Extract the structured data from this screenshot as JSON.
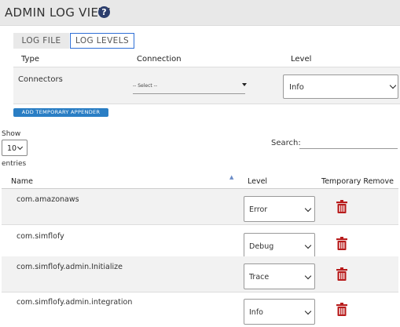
{
  "header": {
    "title": "ADMIN LOG VIEW",
    "help_icon": "help-icon"
  },
  "tabs": [
    {
      "label": "LOG FILE",
      "active": false
    },
    {
      "label": "LOG LEVELS",
      "active": true
    }
  ],
  "connectors": {
    "headers": {
      "type": "Type",
      "connection": "Connection",
      "level": "Level"
    },
    "row": {
      "type": "Connectors",
      "connection": "-- Select --",
      "level": "Info"
    }
  },
  "add_appender_label": "ADD TEMPORARY APPENDER",
  "table_controls": {
    "show_label": "Show",
    "page_length": "10",
    "entries_label": "entries",
    "search_label": "Search:",
    "search_value": ""
  },
  "table": {
    "columns": {
      "name": "Name",
      "level": "Level",
      "remove": "Temporary Remove"
    },
    "rows": [
      {
        "name": "com.amazonaws",
        "level": "Error"
      },
      {
        "name": "com.simflofy",
        "level": "Debug"
      },
      {
        "name": "com.simflofy.admin.Initialize",
        "level": "Trace"
      },
      {
        "name": "com.simflofy.admin.integration",
        "level": "Info"
      }
    ]
  },
  "colors": {
    "accent": "#2a7ec4",
    "tab_border": "#2f6fd6",
    "trash": "#b81c1c",
    "header_bg": "#e8e8e8"
  }
}
